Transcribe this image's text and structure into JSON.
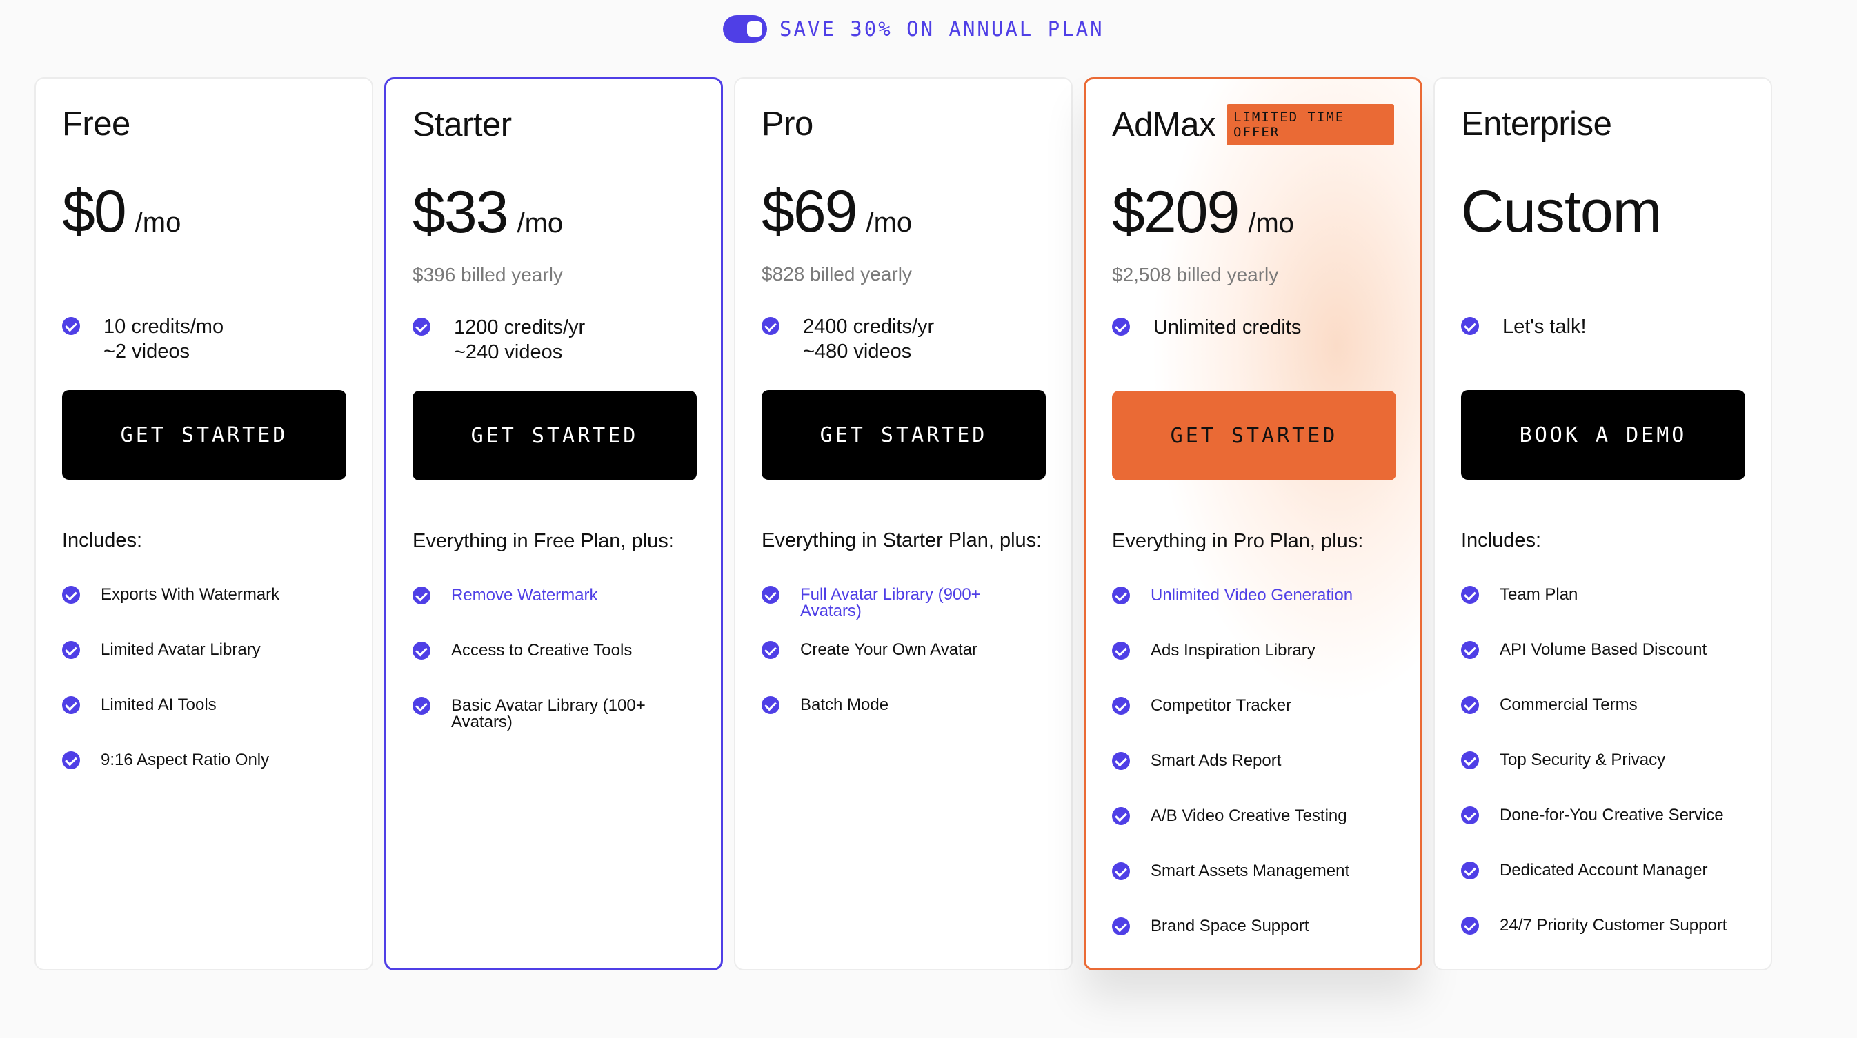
{
  "toggle": {
    "label": "SAVE 30% ON ANNUAL PLAN",
    "on": true
  },
  "colors": {
    "accent": "#4f3fe6",
    "highlight": "#ea6a35"
  },
  "plans": [
    {
      "name": "Free",
      "price": "$0",
      "period": "/mo",
      "billed": "",
      "credits": [
        "10 credits/mo",
        "~2 videos"
      ],
      "cta": "GET STARTED",
      "includes": "Includes:",
      "features": [
        "Exports With Watermark",
        "Limited Avatar Library",
        "Limited AI Tools",
        "9:16 Aspect Ratio Only"
      ]
    },
    {
      "name": "Starter",
      "price": "$33",
      "period": "/mo",
      "billed": "$396 billed yearly",
      "credits": [
        "1200 credits/yr",
        "~240 videos"
      ],
      "cta": "GET STARTED",
      "includes": "Everything in Free Plan, plus:",
      "features": [
        "Remove Watermark",
        "Access to Creative Tools",
        "Basic Avatar Library (100+ Avatars)"
      ]
    },
    {
      "name": "Pro",
      "price": "$69",
      "period": "/mo",
      "billed": "$828 billed yearly",
      "credits": [
        "2400 credits/yr",
        "~480 videos"
      ],
      "cta": "GET STARTED",
      "includes": "Everything in Starter Plan, plus:",
      "features": [
        "Full Avatar Library (900+ Avatars)",
        "Create Your Own Avatar",
        "Batch Mode"
      ]
    },
    {
      "name": "AdMax",
      "badge": "LIMITED TIME OFFER",
      "price": "$209",
      "period": "/mo",
      "billed": "$2,508 billed yearly",
      "credits": [
        "Unlimited credits",
        ""
      ],
      "cta": "GET STARTED",
      "includes": "Everything in Pro Plan, plus:",
      "features": [
        "Unlimited Video Generation",
        "Ads Inspiration Library",
        "Competitor Tracker",
        "Smart Ads Report",
        "A/B Video Creative Testing",
        "Smart Assets Management",
        "Brand Space Support"
      ]
    },
    {
      "name": "Enterprise",
      "price": "Custom",
      "credits": [
        "Let's talk!",
        ""
      ],
      "cta": "BOOK A DEMO",
      "includes": "Includes:",
      "features": [
        "Team Plan",
        "API Volume Based Discount",
        "Commercial Terms",
        "Top Security & Privacy",
        "Done-for-You Creative Service",
        "Dedicated Account Manager",
        "24/7 Priority Customer Support"
      ]
    }
  ]
}
